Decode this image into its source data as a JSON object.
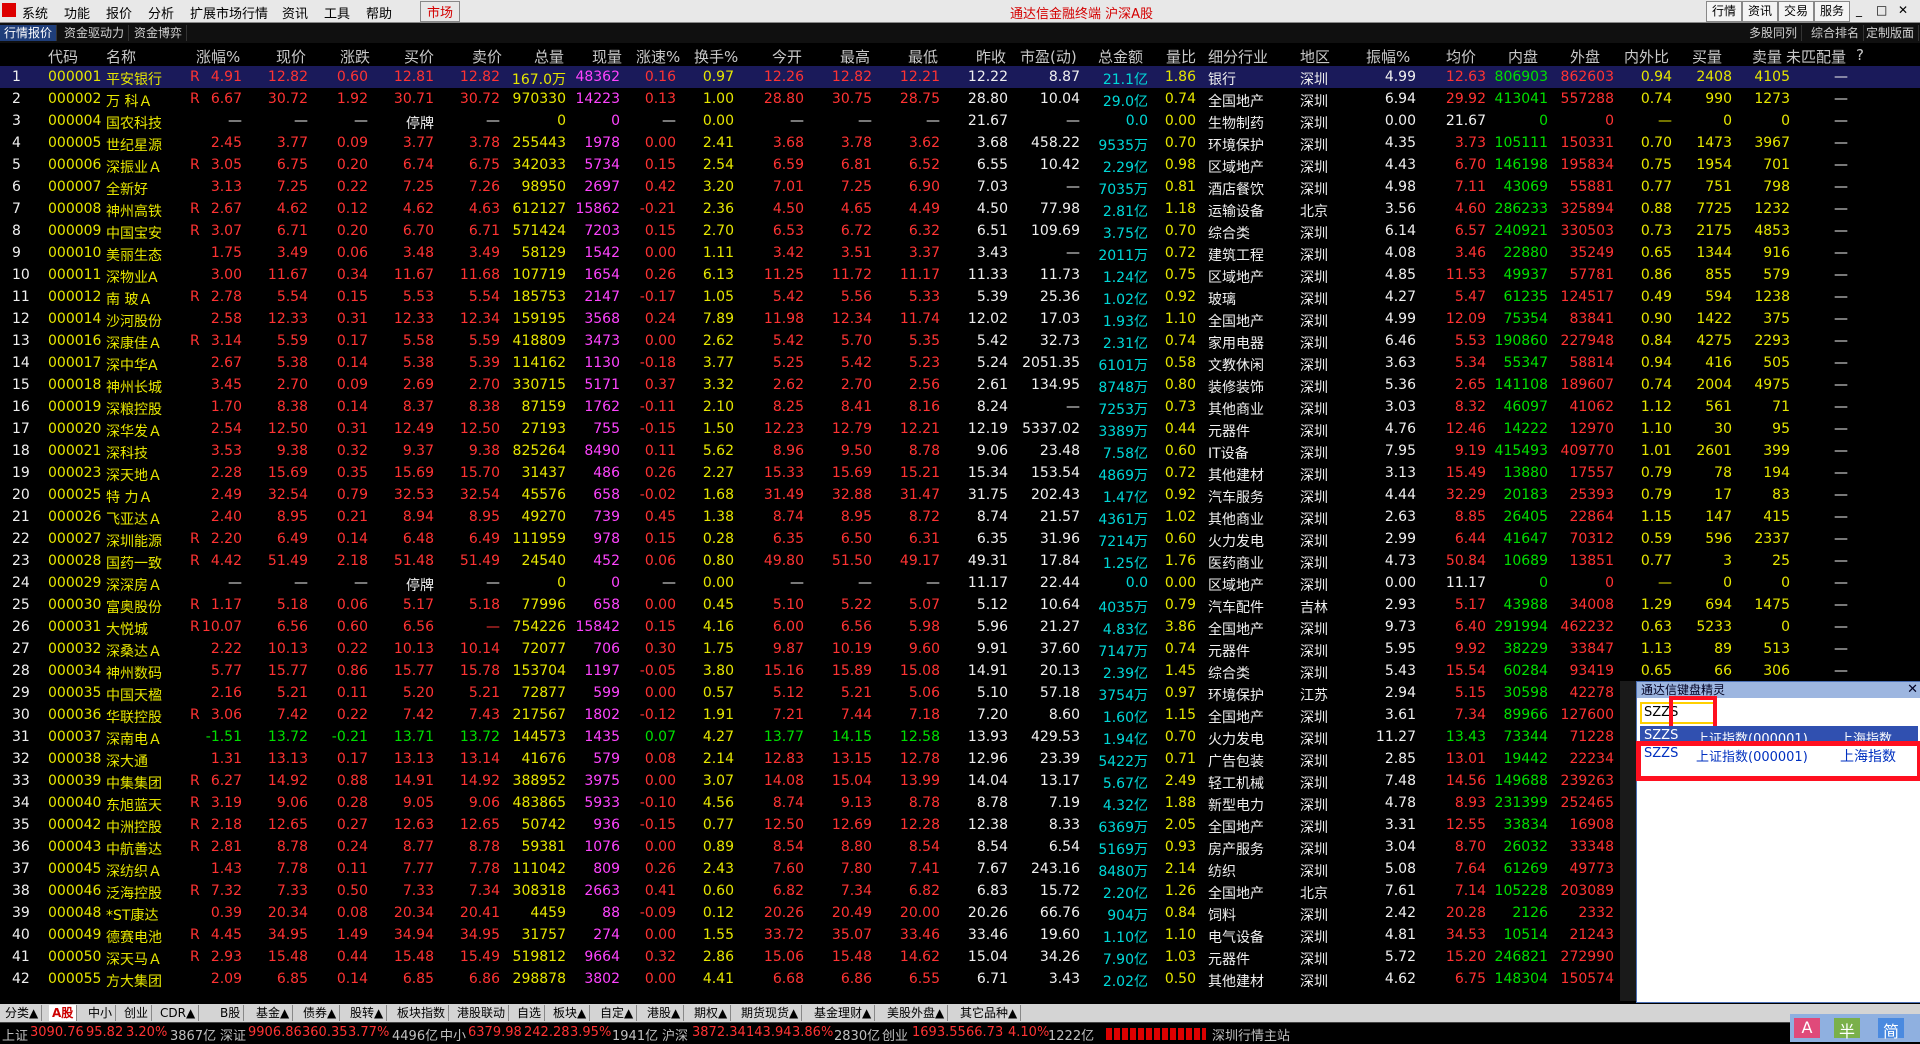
{
  "menu": {
    "items": [
      "系统",
      "功能",
      "报价",
      "分析",
      "扩展市场行情",
      "资讯",
      "工具",
      "帮助"
    ],
    "market_button": "市场",
    "title": "通达信金融终端 沪深A股",
    "right_buttons": [
      "行情",
      "资讯",
      "交易",
      "服务"
    ]
  },
  "subtabs": {
    "left": [
      "行情报价",
      "资金驱动力",
      "资金博弈"
    ],
    "right": [
      "多股同列",
      "综合排名",
      "定制版面"
    ]
  },
  "columns": [
    "",
    "代码",
    "名称",
    "",
    "涨幅%",
    "现价",
    "涨跌",
    "买价",
    "卖价",
    "总量",
    "现量",
    "涨速%",
    "换手%",
    "今开",
    "最高",
    "最低",
    "昨收",
    "市盈(动)",
    "总金额",
    "量比",
    "细分行业",
    "地区",
    "振幅%",
    "均价",
    "内盘",
    "外盘",
    "内外比",
    "买量",
    "卖量",
    "未匹配量",
    "?"
  ],
  "rows": [
    [
      "1",
      "000001",
      "平安银行",
      "R",
      "4.91",
      "12.82",
      "0.60",
      "12.81",
      "12.82",
      "167.0万",
      "48362",
      "0.16",
      "0.97",
      "12.26",
      "12.82",
      "12.21",
      "12.22",
      "8.87",
      "21.1亿",
      "1.86",
      "银行",
      "深圳",
      "4.99",
      "12.63",
      "806903",
      "862603",
      "0.94",
      "2408",
      "4105",
      "—"
    ],
    [
      "2",
      "000002",
      "万 科Ａ",
      "R",
      "6.67",
      "30.72",
      "1.92",
      "30.71",
      "30.72",
      "970330",
      "14223",
      "0.13",
      "1.00",
      "28.80",
      "30.75",
      "28.75",
      "28.80",
      "10.04",
      "29.0亿",
      "0.74",
      "全国地产",
      "深圳",
      "6.94",
      "29.92",
      "413041",
      "557288",
      "0.74",
      "990",
      "1273",
      "—"
    ],
    [
      "3",
      "000004",
      "国农科技",
      "",
      "—",
      "—",
      "—",
      "停牌",
      "—",
      "0",
      "0",
      "—",
      "0.00",
      "—",
      "—",
      "—",
      "21.67",
      "—",
      "0.0",
      "0.00",
      "生物制药",
      "深圳",
      "0.00",
      "21.67",
      "0",
      "0",
      "—",
      "0",
      "0",
      "—"
    ],
    [
      "4",
      "000005",
      "世纪星源",
      "",
      "2.45",
      "3.77",
      "0.09",
      "3.77",
      "3.78",
      "255443",
      "1978",
      "0.00",
      "2.41",
      "3.68",
      "3.78",
      "3.62",
      "3.68",
      "458.22",
      "9535万",
      "0.70",
      "环境保护",
      "深圳",
      "4.35",
      "3.73",
      "105111",
      "150331",
      "0.70",
      "1473",
      "3967",
      "—"
    ],
    [
      "5",
      "000006",
      "深振业Ａ",
      "R",
      "3.05",
      "6.75",
      "0.20",
      "6.74",
      "6.75",
      "342033",
      "5734",
      "0.15",
      "2.54",
      "6.59",
      "6.81",
      "6.52",
      "6.55",
      "10.42",
      "2.29亿",
      "0.98",
      "区域地产",
      "深圳",
      "4.43",
      "6.70",
      "146198",
      "195834",
      "0.75",
      "1954",
      "701",
      "—"
    ],
    [
      "6",
      "000007",
      "全新好",
      "",
      "3.13",
      "7.25",
      "0.22",
      "7.25",
      "7.26",
      "98950",
      "2697",
      "0.42",
      "3.20",
      "7.01",
      "7.25",
      "6.90",
      "7.03",
      "—",
      "7035万",
      "0.81",
      "酒店餐饮",
      "深圳",
      "4.98",
      "7.11",
      "43069",
      "55881",
      "0.77",
      "751",
      "798",
      "—"
    ],
    [
      "7",
      "000008",
      "神州高铁",
      "R",
      "2.67",
      "4.62",
      "0.12",
      "4.62",
      "4.63",
      "612127",
      "15862",
      "-0.21",
      "2.36",
      "4.50",
      "4.65",
      "4.49",
      "4.50",
      "77.98",
      "2.81亿",
      "1.18",
      "运输设备",
      "北京",
      "3.56",
      "4.60",
      "286233",
      "325894",
      "0.88",
      "7725",
      "1232",
      "—"
    ],
    [
      "8",
      "000009",
      "中国宝安",
      "R",
      "3.07",
      "6.71",
      "0.20",
      "6.70",
      "6.71",
      "571424",
      "7203",
      "0.15",
      "2.70",
      "6.53",
      "6.72",
      "6.32",
      "6.51",
      "109.69",
      "3.75亿",
      "0.70",
      "综合类",
      "深圳",
      "6.14",
      "6.57",
      "240921",
      "330503",
      "0.73",
      "2175",
      "4853",
      "—"
    ],
    [
      "9",
      "000010",
      "美丽生态",
      "",
      "1.75",
      "3.49",
      "0.06",
      "3.48",
      "3.49",
      "58129",
      "1542",
      "0.00",
      "1.11",
      "3.42",
      "3.51",
      "3.37",
      "3.43",
      "—",
      "2011万",
      "0.72",
      "建筑工程",
      "深圳",
      "4.08",
      "3.46",
      "22880",
      "35249",
      "0.65",
      "1344",
      "916",
      "—"
    ],
    [
      "10",
      "000011",
      "深物业A",
      "",
      "3.00",
      "11.67",
      "0.34",
      "11.67",
      "11.68",
      "107719",
      "1654",
      "0.26",
      "6.13",
      "11.25",
      "11.72",
      "11.17",
      "11.33",
      "11.73",
      "1.24亿",
      "0.75",
      "区域地产",
      "深圳",
      "4.85",
      "11.53",
      "49937",
      "57781",
      "0.86",
      "855",
      "579",
      "—"
    ],
    [
      "11",
      "000012",
      "南 玻Ａ",
      "R",
      "2.78",
      "5.54",
      "0.15",
      "5.53",
      "5.54",
      "185753",
      "2147",
      "-0.17",
      "1.05",
      "5.42",
      "5.56",
      "5.33",
      "5.39",
      "25.36",
      "1.02亿",
      "0.92",
      "玻璃",
      "深圳",
      "4.27",
      "5.47",
      "61235",
      "124517",
      "0.49",
      "594",
      "1238",
      "—"
    ],
    [
      "12",
      "000014",
      "沙河股份",
      "",
      "2.58",
      "12.33",
      "0.31",
      "12.33",
      "12.34",
      "159195",
      "3568",
      "0.24",
      "7.89",
      "11.98",
      "12.34",
      "11.74",
      "12.02",
      "17.03",
      "1.93亿",
      "1.10",
      "全国地产",
      "深圳",
      "4.99",
      "12.09",
      "75354",
      "83841",
      "0.90",
      "1422",
      "375",
      "—"
    ],
    [
      "13",
      "000016",
      "深康佳Ａ",
      "R",
      "3.14",
      "5.59",
      "0.17",
      "5.58",
      "5.59",
      "418809",
      "3473",
      "0.00",
      "2.62",
      "5.42",
      "5.70",
      "5.35",
      "5.42",
      "32.73",
      "2.31亿",
      "0.74",
      "家用电器",
      "深圳",
      "6.46",
      "5.53",
      "190860",
      "227948",
      "0.84",
      "4275",
      "2293",
      "—"
    ],
    [
      "14",
      "000017",
      "深中华A",
      "",
      "2.67",
      "5.38",
      "0.14",
      "5.38",
      "5.39",
      "114162",
      "1130",
      "-0.18",
      "3.77",
      "5.25",
      "5.42",
      "5.23",
      "5.24",
      "2051.35",
      "6101万",
      "0.58",
      "文教休闲",
      "深圳",
      "3.63",
      "5.34",
      "55347",
      "58814",
      "0.94",
      "416",
      "505",
      "—"
    ],
    [
      "15",
      "000018",
      "神州长城",
      "",
      "3.45",
      "2.70",
      "0.09",
      "2.69",
      "2.70",
      "330715",
      "5171",
      "0.37",
      "3.32",
      "2.62",
      "2.70",
      "2.56",
      "2.61",
      "134.95",
      "8748万",
      "0.80",
      "装修装饰",
      "深圳",
      "5.36",
      "2.65",
      "141108",
      "189607",
      "0.74",
      "2004",
      "4975",
      "—"
    ],
    [
      "16",
      "000019",
      "深粮控股",
      "",
      "1.70",
      "8.38",
      "0.14",
      "8.37",
      "8.38",
      "87159",
      "1762",
      "-0.11",
      "2.10",
      "8.25",
      "8.41",
      "8.16",
      "8.24",
      "—",
      "7253万",
      "0.73",
      "其他商业",
      "深圳",
      "3.03",
      "8.32",
      "46097",
      "41062",
      "1.12",
      "561",
      "71",
      "—"
    ],
    [
      "17",
      "000020",
      "深华发Ａ",
      "",
      "2.54",
      "12.50",
      "0.31",
      "12.49",
      "12.50",
      "27193",
      "755",
      "-0.15",
      "1.50",
      "12.23",
      "12.79",
      "12.21",
      "12.19",
      "5337.02",
      "3389万",
      "0.44",
      "元器件",
      "深圳",
      "4.76",
      "12.46",
      "14222",
      "12970",
      "1.10",
      "30",
      "95",
      "—"
    ],
    [
      "18",
      "000021",
      "深科技",
      "",
      "3.53",
      "9.38",
      "0.32",
      "9.37",
      "9.38",
      "825264",
      "8490",
      "0.11",
      "5.62",
      "8.96",
      "9.50",
      "8.78",
      "9.06",
      "23.48",
      "7.58亿",
      "0.60",
      "IT设备",
      "深圳",
      "7.95",
      "9.19",
      "415493",
      "409770",
      "1.01",
      "2601",
      "399",
      "—"
    ],
    [
      "19",
      "000023",
      "深天地Ａ",
      "",
      "2.28",
      "15.69",
      "0.35",
      "15.69",
      "15.70",
      "31437",
      "486",
      "0.26",
      "2.27",
      "15.33",
      "15.69",
      "15.21",
      "15.34",
      "153.54",
      "4869万",
      "0.72",
      "其他建材",
      "深圳",
      "3.13",
      "15.49",
      "13880",
      "17557",
      "0.79",
      "78",
      "194",
      "—"
    ],
    [
      "20",
      "000025",
      "特 力Ａ",
      "",
      "2.49",
      "32.54",
      "0.79",
      "32.53",
      "32.54",
      "45576",
      "658",
      "-0.02",
      "1.68",
      "31.49",
      "32.88",
      "31.47",
      "31.75",
      "202.43",
      "1.47亿",
      "0.92",
      "汽车服务",
      "深圳",
      "4.44",
      "32.29",
      "20183",
      "25393",
      "0.79",
      "17",
      "83",
      "—"
    ],
    [
      "21",
      "000026",
      "飞亚达Ａ",
      "",
      "2.40",
      "8.95",
      "0.21",
      "8.94",
      "8.95",
      "49270",
      "739",
      "0.45",
      "1.38",
      "8.74",
      "8.95",
      "8.72",
      "8.74",
      "21.57",
      "4361万",
      "1.02",
      "其他商业",
      "深圳",
      "2.63",
      "8.85",
      "26405",
      "22864",
      "1.15",
      "147",
      "415",
      "—"
    ],
    [
      "22",
      "000027",
      "深圳能源",
      "R",
      "2.20",
      "6.49",
      "0.14",
      "6.48",
      "6.49",
      "111959",
      "978",
      "0.15",
      "0.28",
      "6.35",
      "6.50",
      "6.31",
      "6.35",
      "31.96",
      "7214万",
      "0.60",
      "火力发电",
      "深圳",
      "2.99",
      "6.44",
      "41647",
      "70312",
      "0.59",
      "596",
      "2337",
      "—"
    ],
    [
      "23",
      "000028",
      "国药一致",
      "R",
      "4.42",
      "51.49",
      "2.18",
      "51.48",
      "51.49",
      "24540",
      "452",
      "0.06",
      "0.80",
      "49.80",
      "51.50",
      "49.17",
      "49.31",
      "17.84",
      "1.25亿",
      "1.76",
      "医药商业",
      "深圳",
      "4.73",
      "50.84",
      "10689",
      "13851",
      "0.77",
      "3",
      "25",
      "—"
    ],
    [
      "24",
      "000029",
      "深深房Ａ",
      "",
      "—",
      "—",
      "—",
      "停牌",
      "—",
      "0",
      "0",
      "—",
      "0.00",
      "—",
      "—",
      "—",
      "11.17",
      "22.44",
      "0.0",
      "0.00",
      "区域地产",
      "深圳",
      "0.00",
      "11.17",
      "0",
      "0",
      "—",
      "0",
      "0",
      "—"
    ],
    [
      "25",
      "000030",
      "富奥股份",
      "R",
      "1.17",
      "5.18",
      "0.06",
      "5.17",
      "5.18",
      "77996",
      "658",
      "0.00",
      "0.45",
      "5.10",
      "5.22",
      "5.07",
      "5.12",
      "10.64",
      "4035万",
      "0.79",
      "汽车配件",
      "吉林",
      "2.93",
      "5.17",
      "43988",
      "34008",
      "1.29",
      "694",
      "1475",
      "—"
    ],
    [
      "26",
      "000031",
      "大悦城",
      "R",
      "10.07",
      "6.56",
      "0.60",
      "6.56",
      "—",
      "754226",
      "15842",
      "0.15",
      "4.16",
      "6.00",
      "6.56",
      "5.98",
      "5.96",
      "21.27",
      "4.83亿",
      "3.86",
      "全国地产",
      "深圳",
      "9.73",
      "6.40",
      "291994",
      "462232",
      "0.63",
      "5233",
      "0",
      "—"
    ],
    [
      "27",
      "000032",
      "深桑达Ａ",
      "",
      "2.22",
      "10.13",
      "0.22",
      "10.13",
      "10.14",
      "72077",
      "706",
      "0.30",
      "1.75",
      "9.87",
      "10.19",
      "9.60",
      "9.91",
      "37.60",
      "7147万",
      "0.74",
      "元器件",
      "深圳",
      "5.95",
      "9.92",
      "38229",
      "33847",
      "1.13",
      "89",
      "513",
      "—"
    ],
    [
      "28",
      "000034",
      "神州数码",
      "",
      "5.77",
      "15.77",
      "0.86",
      "15.77",
      "15.78",
      "153704",
      "1197",
      "-0.05",
      "3.80",
      "15.16",
      "15.89",
      "15.08",
      "14.91",
      "20.13",
      "2.39亿",
      "1.45",
      "综合类",
      "深圳",
      "5.43",
      "15.54",
      "60284",
      "93419",
      "0.65",
      "66",
      "306",
      "—"
    ],
    [
      "29",
      "000035",
      "中国天楹",
      "",
      "2.16",
      "5.21",
      "0.11",
      "5.20",
      "5.21",
      "72877",
      "599",
      "0.00",
      "0.57",
      "5.12",
      "5.21",
      "5.06",
      "5.10",
      "57.18",
      "3754万",
      "0.97",
      "环境保护",
      "江苏",
      "2.94",
      "5.15",
      "30598",
      "42278",
      "—",
      "—",
      "—",
      "—"
    ],
    [
      "30",
      "000036",
      "华联控股",
      "R",
      "3.06",
      "7.42",
      "0.22",
      "7.42",
      "7.43",
      "217567",
      "1802",
      "-0.12",
      "1.91",
      "7.21",
      "7.44",
      "7.18",
      "7.20",
      "8.60",
      "1.60亿",
      "1.15",
      "全国地产",
      "深圳",
      "3.61",
      "7.34",
      "89966",
      "127600",
      "—",
      "—",
      "—",
      "—"
    ],
    [
      "31",
      "000037",
      "深南电Ａ",
      "",
      "-1.51",
      "13.72",
      "-0.21",
      "13.71",
      "13.72",
      "144573",
      "1435",
      "0.07",
      "4.27",
      "13.77",
      "14.15",
      "12.58",
      "13.93",
      "429.53",
      "1.94亿",
      "0.70",
      "火力发电",
      "深圳",
      "11.27",
      "13.43",
      "73344",
      "71228",
      "—",
      "—",
      "—",
      "—"
    ],
    [
      "32",
      "000038",
      "深大通",
      "",
      "1.31",
      "13.13",
      "0.17",
      "13.13",
      "13.14",
      "41676",
      "579",
      "0.08",
      "2.14",
      "12.83",
      "13.15",
      "12.78",
      "12.96",
      "23.39",
      "5422万",
      "0.71",
      "广告包装",
      "深圳",
      "2.85",
      "13.01",
      "19442",
      "22234",
      "—",
      "—",
      "—",
      "—"
    ],
    [
      "33",
      "000039",
      "中集集团",
      "R",
      "6.27",
      "14.92",
      "0.88",
      "14.91",
      "14.92",
      "388952",
      "3975",
      "0.00",
      "3.07",
      "14.08",
      "15.04",
      "13.99",
      "14.04",
      "13.17",
      "5.67亿",
      "2.49",
      "轻工机械",
      "深圳",
      "7.48",
      "14.56",
      "149688",
      "239263",
      "—",
      "—",
      "—",
      "—"
    ],
    [
      "34",
      "000040",
      "东旭蓝天",
      "R",
      "3.19",
      "9.06",
      "0.28",
      "9.05",
      "9.06",
      "483865",
      "5933",
      "-0.10",
      "4.56",
      "8.74",
      "9.13",
      "8.78",
      "8.78",
      "7.19",
      "4.32亿",
      "1.88",
      "新型电力",
      "深圳",
      "4.78",
      "8.93",
      "231399",
      "252465",
      "—",
      "—",
      "—",
      "—"
    ],
    [
      "35",
      "000042",
      "中洲控股",
      "R",
      "2.18",
      "12.65",
      "0.27",
      "12.63",
      "12.65",
      "50742",
      "936",
      "-0.15",
      "0.77",
      "12.50",
      "12.69",
      "12.28",
      "12.38",
      "8.33",
      "6369万",
      "2.05",
      "全国地产",
      "深圳",
      "3.31",
      "12.55",
      "33834",
      "16908",
      "—",
      "—",
      "—",
      "—"
    ],
    [
      "36",
      "000043",
      "中航善达",
      "R",
      "2.81",
      "8.78",
      "0.24",
      "8.77",
      "8.78",
      "59381",
      "1076",
      "0.00",
      "0.89",
      "8.54",
      "8.80",
      "8.54",
      "8.54",
      "6.54",
      "5169万",
      "0.93",
      "房产服务",
      "深圳",
      "3.04",
      "8.70",
      "26032",
      "33348",
      "—",
      "—",
      "—",
      "—"
    ],
    [
      "37",
      "000045",
      "深纺织Ａ",
      "",
      "1.43",
      "7.78",
      "0.11",
      "7.77",
      "7.78",
      "111042",
      "809",
      "0.26",
      "2.43",
      "7.60",
      "7.80",
      "7.41",
      "7.67",
      "243.16",
      "8480万",
      "2.14",
      "纺织",
      "深圳",
      "5.08",
      "7.64",
      "61269",
      "49773",
      "—",
      "—",
      "—",
      "—"
    ],
    [
      "38",
      "000046",
      "泛海控股",
      "R",
      "7.32",
      "7.33",
      "0.50",
      "7.33",
      "7.34",
      "308318",
      "2663",
      "0.41",
      "0.60",
      "6.82",
      "7.34",
      "6.82",
      "6.83",
      "15.72",
      "2.20亿",
      "1.26",
      "全国地产",
      "北京",
      "7.61",
      "7.14",
      "105228",
      "203089",
      "—",
      "—",
      "—",
      "—"
    ],
    [
      "39",
      "000048",
      "*ST康达",
      "",
      "0.39",
      "20.34",
      "0.08",
      "20.34",
      "20.41",
      "4459",
      "88",
      "-0.09",
      "0.12",
      "20.26",
      "20.49",
      "20.00",
      "20.26",
      "66.76",
      "904万",
      "0.84",
      "饲料",
      "深圳",
      "2.42",
      "20.28",
      "2126",
      "2332",
      "—",
      "—",
      "—",
      "—"
    ],
    [
      "40",
      "000049",
      "德赛电池",
      "R",
      "4.45",
      "34.95",
      "1.49",
      "34.94",
      "34.95",
      "31757",
      "274",
      "0.00",
      "1.55",
      "33.72",
      "35.07",
      "33.46",
      "33.46",
      "19.60",
      "1.10亿",
      "1.10",
      "电气设备",
      "深圳",
      "4.81",
      "34.53",
      "10514",
      "21243",
      "—",
      "—",
      "—",
      "—"
    ],
    [
      "41",
      "000050",
      "深天马Ａ",
      "R",
      "2.93",
      "15.48",
      "0.44",
      "15.48",
      "15.49",
      "519812",
      "9664",
      "0.32",
      "2.86",
      "15.06",
      "15.48",
      "14.62",
      "15.04",
      "34.26",
      "7.90亿",
      "1.03",
      "元器件",
      "深圳",
      "5.72",
      "15.20",
      "246821",
      "272990",
      "—",
      "—",
      "—",
      "—"
    ],
    [
      "42",
      "000055",
      "方大集团",
      "",
      "2.09",
      "6.85",
      "0.14",
      "6.85",
      "6.86",
      "298878",
      "3802",
      "0.00",
      "4.41",
      "6.68",
      "6.86",
      "6.55",
      "6.71",
      "3.43",
      "2.02亿",
      "0.50",
      "其他建材",
      "深圳",
      "4.62",
      "6.75",
      "148304",
      "150574",
      "—",
      "—",
      "—",
      "—"
    ]
  ],
  "bottom_tabs": [
    "分类▲",
    "A股",
    "中小",
    "创业",
    "CDR▲",
    "B股",
    "基金▲",
    "债券▲",
    "股转▲",
    "板块指数",
    "港股联动",
    "自选",
    "板块▲",
    "自定▲",
    "港股▲",
    "期权▲",
    "期货现货▲",
    "基金理财▲",
    "美股外盘▲",
    "其它品种▲"
  ],
  "status": {
    "sh_label": "上证",
    "sh_val": "3090.76",
    "sh_chg": "95.82",
    "sh_pct": "3.20%",
    "sh_amt": "3867亿",
    "sz_label": "深证",
    "sz_val": "9906.86",
    "sz_chg": "360.35",
    "sz_pct": "3.77%",
    "sz_amt": "4496亿",
    "zx_label": "中小",
    "zx_val": "6379.98",
    "zx_chg": "242.28",
    "zx_pct": "3.95%",
    "zx_amt": "1941亿",
    "hs_label": "沪深",
    "hs_val": "3872.34",
    "hs_chg": "143.94",
    "hs_pct": "3.86%",
    "hs_amt": "2830亿",
    "cy_label": "创业",
    "cy_val": "1693.55",
    "cy_chg": "66.73",
    "cy_pct": "4.10%",
    "cy_amt": "1222亿",
    "server": "深圳行情主站",
    "corner": [
      "A",
      "半",
      "简"
    ]
  },
  "popup": {
    "title": "通达信键盘精灵",
    "input_value": "SZZS",
    "results": [
      {
        "code": "SZZS",
        "name": "上证指数(000001)",
        "market": "上海指数"
      },
      {
        "code": "SZZS",
        "name": "上证指数(000001)",
        "market": "上海指数"
      }
    ]
  }
}
